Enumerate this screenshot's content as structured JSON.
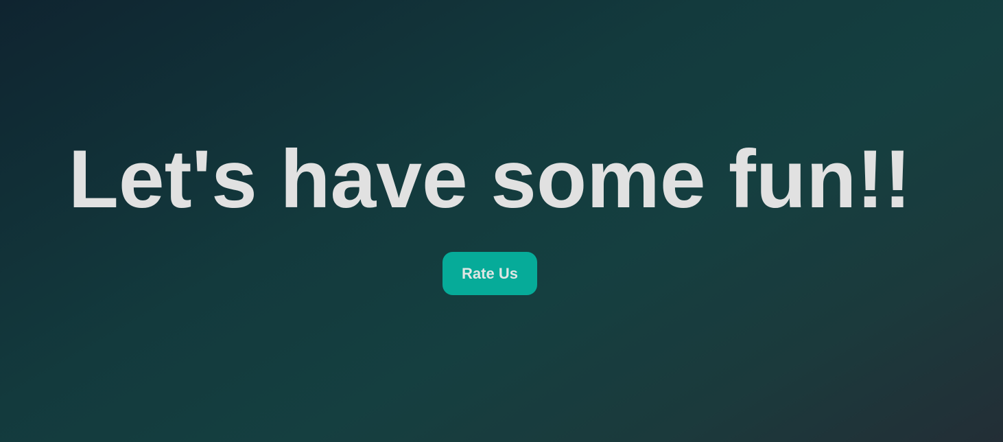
{
  "hero": {
    "heading": "Let's have some fun!!",
    "button_label": "Rate Us"
  },
  "colors": {
    "accent": "#06ab99",
    "text": "#e1e1e1"
  }
}
